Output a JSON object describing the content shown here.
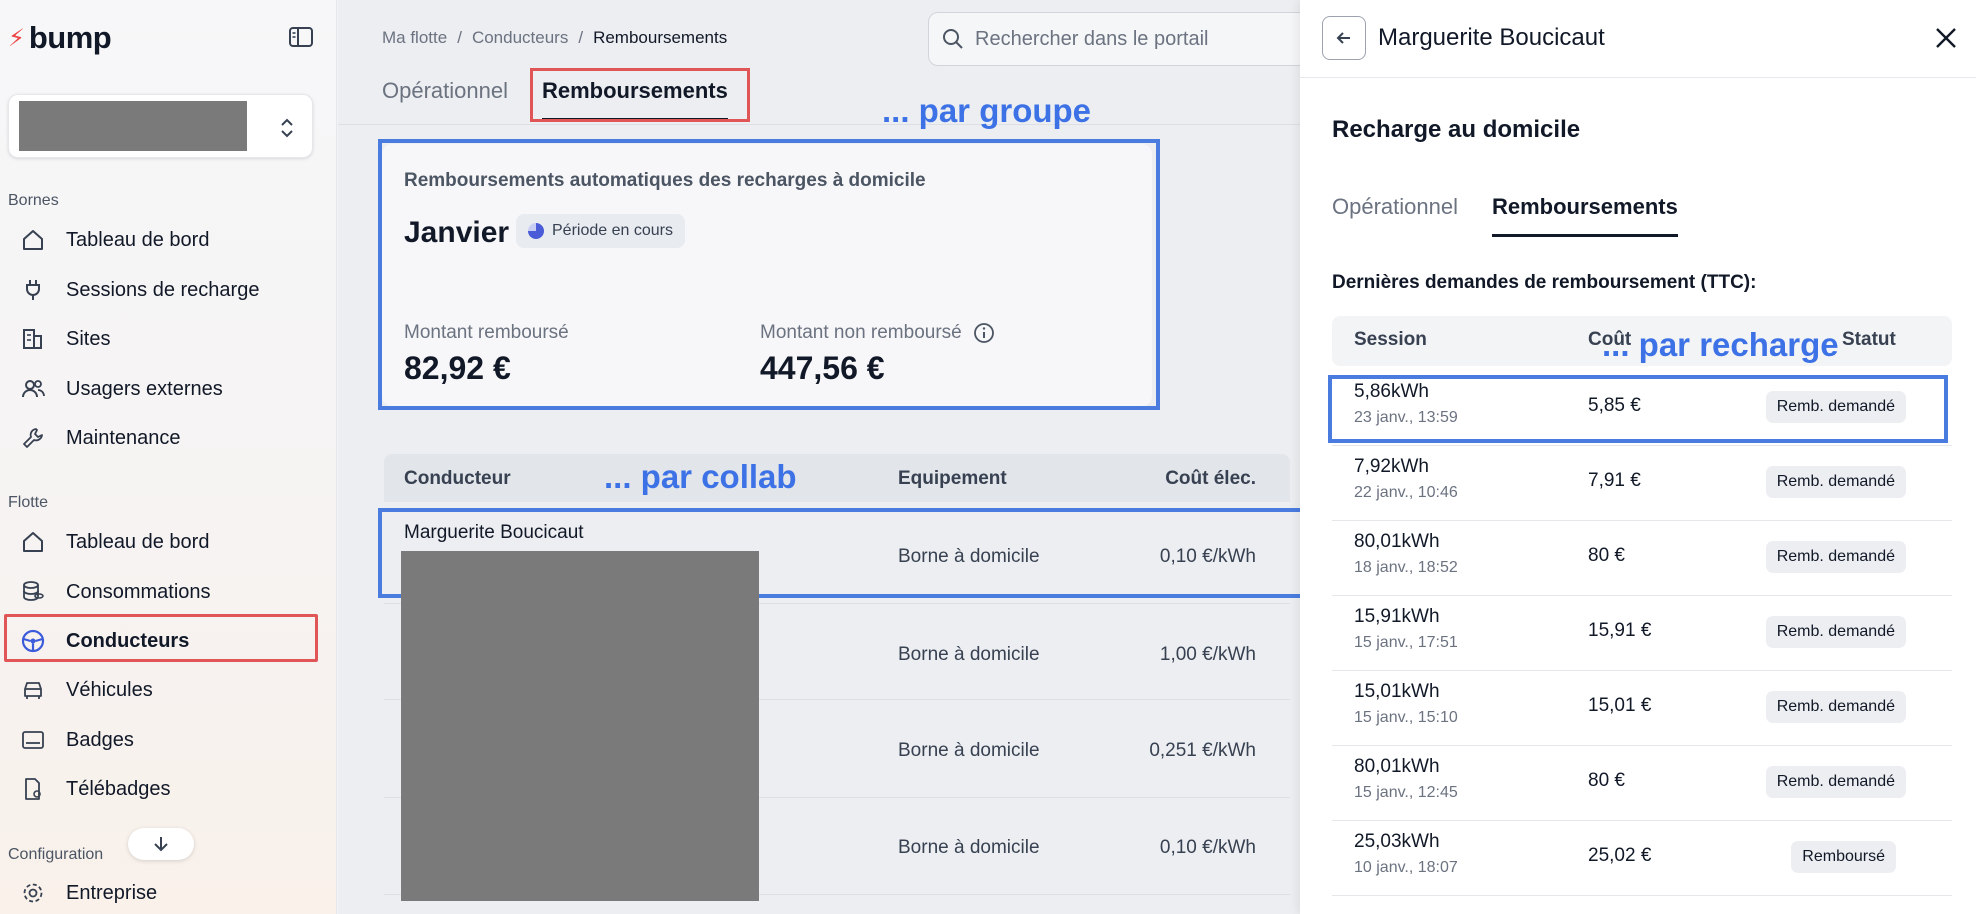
{
  "sidebar": {
    "logo_text": "bump",
    "sections": {
      "bornes": "Bornes",
      "flotte": "Flotte",
      "configuration": "Configuration"
    },
    "bornes_items": [
      {
        "label": "Tableau de bord",
        "icon": "home-icon"
      },
      {
        "label": "Sessions de recharge",
        "icon": "plug-icon"
      },
      {
        "label": "Sites",
        "icon": "building-icon"
      },
      {
        "label": "Usagers externes",
        "icon": "users-icon"
      },
      {
        "label": "Maintenance",
        "icon": "wrench-icon"
      }
    ],
    "flotte_items": [
      {
        "label": "Tableau de bord",
        "icon": "home-icon"
      },
      {
        "label": "Consommations",
        "icon": "coins-icon"
      },
      {
        "label": "Conducteurs",
        "icon": "steering-wheel-icon",
        "active": true
      },
      {
        "label": "Véhicules",
        "icon": "car-icon"
      },
      {
        "label": "Badges",
        "icon": "card-icon"
      },
      {
        "label": "Télébadges",
        "icon": "tag-icon"
      }
    ],
    "config_items": [
      {
        "label": "Entreprise",
        "icon": "gear-icon"
      }
    ]
  },
  "breadcrumb": {
    "item1": "Ma flotte",
    "item2": "Conducteurs",
    "current": "Remboursements",
    "sep": "/"
  },
  "search": {
    "placeholder": "Rechercher dans le portail"
  },
  "tabs": {
    "operational": "Opérationnel",
    "reimbursements": "Remboursements"
  },
  "summary": {
    "title": "Remboursements automatiques des recharges à domicile",
    "month": "Janvier",
    "period_badge": "Période en cours",
    "reimbursed_label": "Montant remboursé",
    "reimbursed_value": "82,92 €",
    "not_reimbursed_label": "Montant non remboursé",
    "not_reimbursed_value": "447,56 €"
  },
  "annotations": {
    "group": "... par groupe",
    "collab": "... par collab",
    "recharge": "... par recharge"
  },
  "table": {
    "headers": {
      "driver": "Conducteur",
      "equipment": "Equipement",
      "cost": "Coût élec."
    },
    "rows": [
      {
        "driver": "Marguerite Boucicaut",
        "equipment": "Borne à domicile",
        "cost": "0,10 €/kWh"
      },
      {
        "driver": "",
        "equipment": "Borne à domicile",
        "cost": "1,00 €/kWh"
      },
      {
        "driver": "",
        "equipment": "Borne à domicile",
        "cost": "0,251 €/kWh"
      },
      {
        "driver": "",
        "equipment": "Borne à domicile",
        "cost": "0,10 €/kWh"
      }
    ]
  },
  "drawer": {
    "title": "Marguerite Boucicaut",
    "section": "Recharge au domicile",
    "tabs": {
      "operational": "Opérationnel",
      "reimbursements": "Remboursements"
    },
    "subtitle": "Dernières demandes de remboursement (TTC):",
    "headers": {
      "session": "Session",
      "cost": "Coût",
      "status": "Statut"
    },
    "rows": [
      {
        "kwh": "5,86kWh",
        "date": "23 janv., 13:59",
        "cost": "5,85 €",
        "status": "Remb. demandé"
      },
      {
        "kwh": "7,92kWh",
        "date": "22 janv., 10:46",
        "cost": "7,91 €",
        "status": "Remb. demandé"
      },
      {
        "kwh": "80,01kWh",
        "date": "18 janv., 18:52",
        "cost": "80 €",
        "status": "Remb. demandé"
      },
      {
        "kwh": "15,91kWh",
        "date": "15 janv., 17:51",
        "cost": "15,91 €",
        "status": "Remb. demandé"
      },
      {
        "kwh": "15,01kWh",
        "date": "15 janv., 15:10",
        "cost": "15,01 €",
        "status": "Remb. demandé"
      },
      {
        "kwh": "80,01kWh",
        "date": "15 janv., 12:45",
        "cost": "80 €",
        "status": "Remb. demandé"
      },
      {
        "kwh": "25,03kWh",
        "date": "10 janv., 18:07",
        "cost": "25,02 €",
        "status": "Remboursé"
      }
    ]
  }
}
